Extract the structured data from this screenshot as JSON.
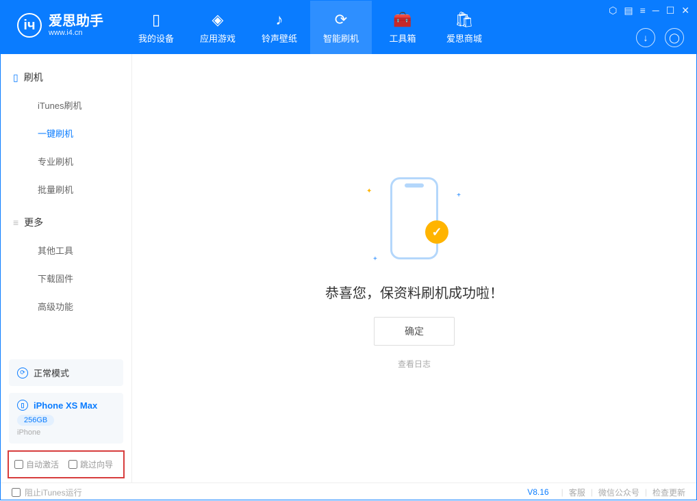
{
  "header": {
    "logo_title": "爱思助手",
    "logo_sub": "www.i4.cn",
    "nav": [
      {
        "label": "我的设备"
      },
      {
        "label": "应用游戏"
      },
      {
        "label": "铃声壁纸"
      },
      {
        "label": "智能刷机"
      },
      {
        "label": "工具箱"
      },
      {
        "label": "爱思商城"
      }
    ]
  },
  "sidebar": {
    "section1": {
      "title": "刷机",
      "items": [
        {
          "label": "iTunes刷机"
        },
        {
          "label": "一键刷机"
        },
        {
          "label": "专业刷机"
        },
        {
          "label": "批量刷机"
        }
      ]
    },
    "section2": {
      "title": "更多",
      "items": [
        {
          "label": "其他工具"
        },
        {
          "label": "下载固件"
        },
        {
          "label": "高级功能"
        }
      ]
    },
    "mode_label": "正常模式",
    "device_name": "iPhone XS Max",
    "device_storage": "256GB",
    "device_type": "iPhone",
    "checkbox1": "自动激活",
    "checkbox2": "跳过向导"
  },
  "content": {
    "success_text": "恭喜您，保资料刷机成功啦！",
    "ok_button": "确定",
    "log_link": "查看日志"
  },
  "footer": {
    "block_itunes": "阻止iTunes运行",
    "version": "V8.16",
    "links": [
      "客服",
      "微信公众号",
      "检查更新"
    ]
  }
}
